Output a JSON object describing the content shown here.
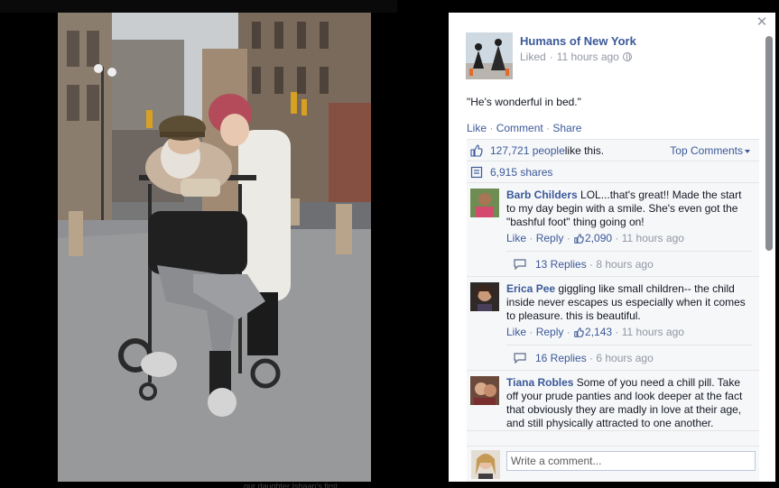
{
  "background": {
    "bottom_text": "our daughter Ishaan's first"
  },
  "post": {
    "page_name": "Humans of New York",
    "status": "Liked",
    "separator": " · ",
    "time": "11 hours ago",
    "caption": "\"He's wonderful in bed.\"",
    "actions": [
      "Like",
      "Comment",
      "Share"
    ],
    "likes_count": "127,721 people",
    "likes_suffix": " like this.",
    "top_comments_label": "Top Comments",
    "shares": "6,915 shares"
  },
  "comments": [
    {
      "author": "Barb Childers",
      "text": " LOL...that's great!! Made the start to my day begin with a smile. She's even got the \"bashful foot\" thing going on!",
      "like": "Like",
      "reply": "Reply",
      "like_count": "2,090",
      "time": "11 hours ago",
      "replies_label": "13 Replies",
      "replies_time": "8 hours ago"
    },
    {
      "author": "Erica Pee",
      "text": " giggling like small children-- the child inside never escapes us especially when it comes to pleasure. this is beautiful.",
      "like": "Like",
      "reply": "Reply",
      "like_count": "2,143",
      "time": "11 hours ago",
      "replies_label": "16 Replies",
      "replies_time": "6 hours ago"
    },
    {
      "author": "Tiana Robles",
      "text": " Some of you need a chill pill. Take off your prude panties and look deeper at the fact that obviously they are madly in love at their age, and still physically attracted to one another."
    }
  ],
  "composer": {
    "placeholder": "Write a comment..."
  },
  "colors": {
    "link": "#3b5998",
    "muted": "#9197a3",
    "panel_bg": "#f6f7f9"
  },
  "icons": [
    "close-icon",
    "globe-icon",
    "like-thumb-icon",
    "share-icon",
    "reply-bubble-icon"
  ]
}
